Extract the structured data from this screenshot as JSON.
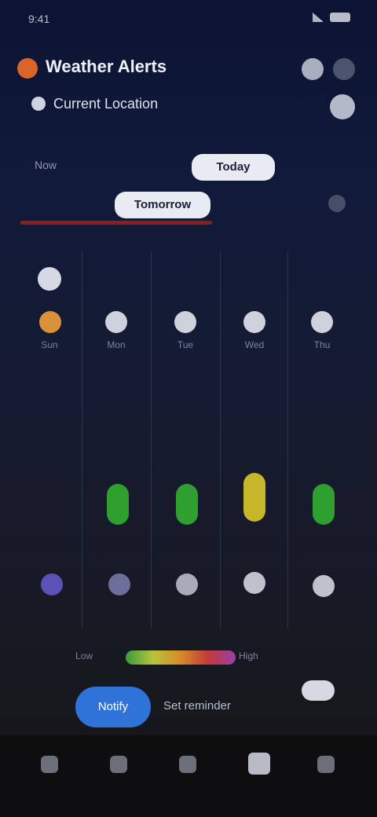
{
  "status_bar": {
    "time": "9:41",
    "battery": ""
  },
  "header": {
    "title": "Weather Alerts",
    "location": "Current Location"
  },
  "controls": {
    "label_left": "Now",
    "pill_top": "Today",
    "pill_bottom": "Tomorrow"
  },
  "grid": {
    "columns": [
      {
        "name": "Sun"
      },
      {
        "name": "Mon"
      },
      {
        "name": "Tue"
      },
      {
        "name": "Wed"
      },
      {
        "name": "Thu"
      }
    ],
    "top_row": [
      "",
      "",
      "",
      "",
      ""
    ],
    "level_colors": [
      "",
      "#2f9f2f",
      "#2f9f2f",
      "#c8b62a",
      "#2f9f2f"
    ],
    "bottom_row": [
      "",
      "",
      "",
      "",
      ""
    ]
  },
  "legend": {
    "low": "Low",
    "high": "High"
  },
  "cta": {
    "button": "Notify",
    "text": "Set reminder"
  },
  "nav": {
    "items": [
      "home",
      "alerts",
      "map",
      "profile",
      "settings"
    ]
  }
}
